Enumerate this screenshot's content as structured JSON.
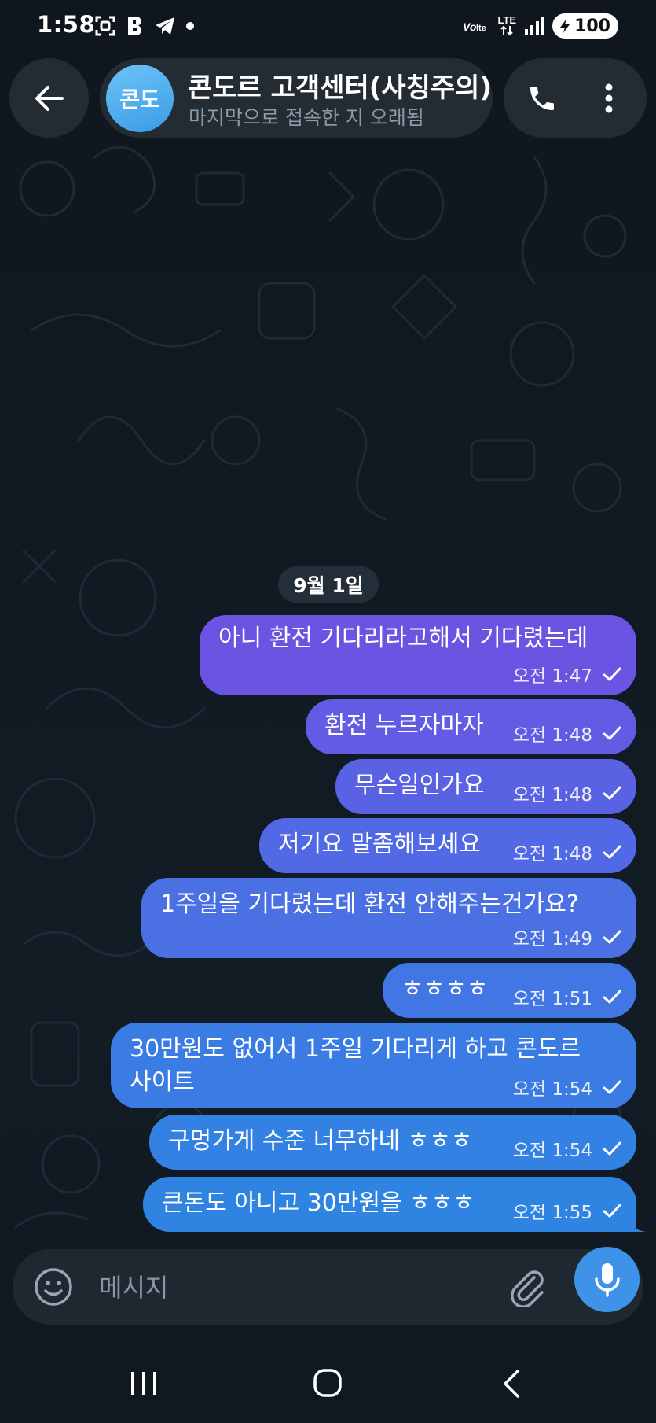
{
  "status_bar": {
    "time": "1:58",
    "network": "LTE",
    "battery": "100"
  },
  "header": {
    "avatar_text": "콘도",
    "title": "콘도르 고객센터(사칭주의)",
    "subtitle": "마지막으로 접속한 지 오래됨"
  },
  "date_chip": "9월 1일",
  "messages": [
    {
      "text": "아니 환전 기다리라고해서 기다렸는데",
      "time": "오전 1:47"
    },
    {
      "text": "환전 누르자마자",
      "time": "오전 1:48"
    },
    {
      "text": "무슨일인가요",
      "time": "오전 1:48"
    },
    {
      "text": "저기요 말좀해보세요",
      "time": "오전 1:48"
    },
    {
      "text": "1주일을 기다렸는데  환전 안해주는건가요?",
      "time": "오전 1:49"
    },
    {
      "text": "ㅎㅎㅎㅎ",
      "time": "오전 1:51"
    },
    {
      "text_line1": "30만원도 없어서 1주일 기다리게 하고 콘도르",
      "text_line2": "사이트",
      "time": "오전 1:54"
    },
    {
      "text": "구멍가게 수준 너무하네 ㅎㅎㅎ",
      "time": "오전 1:54"
    },
    {
      "text": "큰돈도 아니고 30만원을 ㅎㅎㅎ",
      "time": "오전 1:55"
    }
  ],
  "input": {
    "placeholder": "메시지"
  },
  "colors": {
    "bubble_top": "#7a52e0",
    "bubble_bottom": "#2f84e2",
    "accent": "#3e93e8"
  }
}
